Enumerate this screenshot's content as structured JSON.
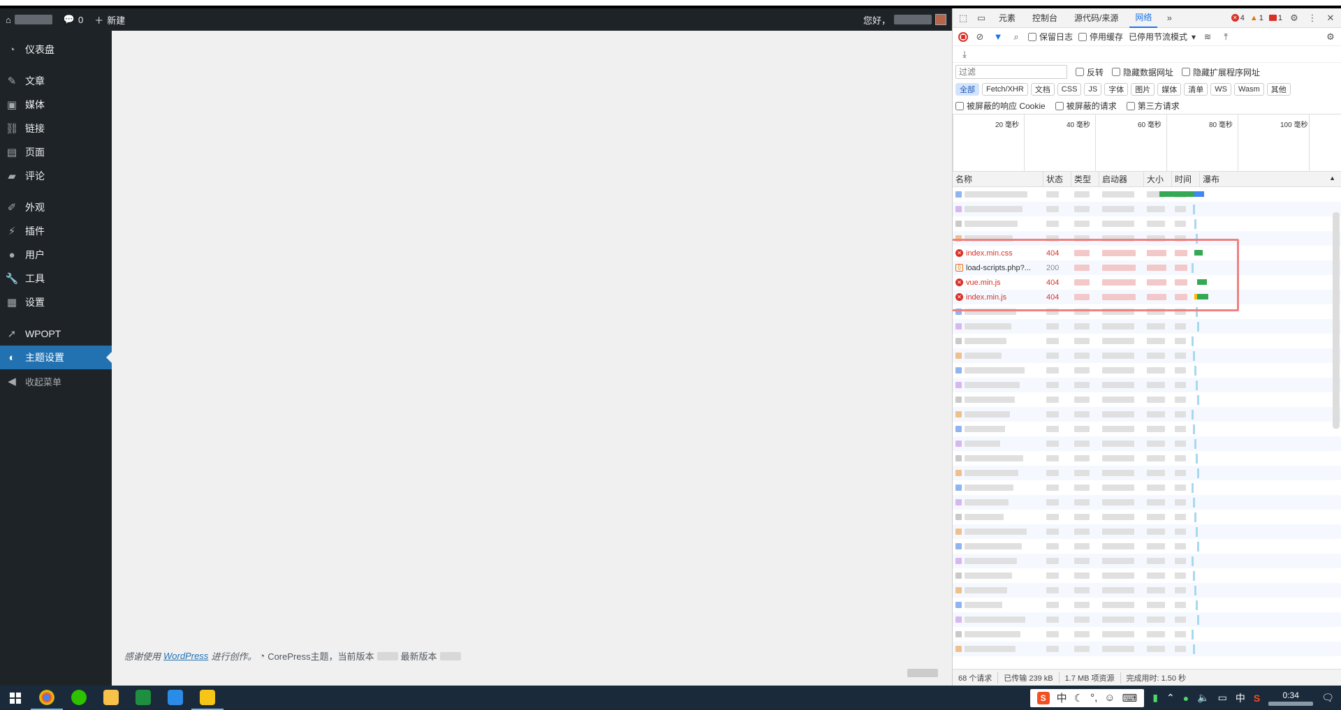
{
  "adminbar": {
    "comments_count": "0",
    "new_label": "新建",
    "greeting": "您好，"
  },
  "sidebar": {
    "items": [
      {
        "label": "仪表盘",
        "icon": "dashboard-icon"
      },
      {
        "label": "文章",
        "icon": "pin-icon"
      },
      {
        "label": "媒体",
        "icon": "media-icon"
      },
      {
        "label": "链接",
        "icon": "link-icon"
      },
      {
        "label": "页面",
        "icon": "page-icon"
      },
      {
        "label": "评论",
        "icon": "comment-icon"
      },
      {
        "label": "外观",
        "icon": "brush-icon"
      },
      {
        "label": "插件",
        "icon": "plugin-icon"
      },
      {
        "label": "用户",
        "icon": "user-icon"
      },
      {
        "label": "工具",
        "icon": "wrench-icon"
      },
      {
        "label": "设置",
        "icon": "settings-icon"
      },
      {
        "label": "WPOPT",
        "icon": "rocket-icon"
      },
      {
        "label": "主题设置",
        "icon": "theme-icon"
      },
      {
        "label": "收起菜单",
        "icon": "collapse-icon"
      }
    ]
  },
  "footer": {
    "thanks_prefix": "感谢使用",
    "wordpress_link": "WordPress",
    "thanks_suffix": "进行创作。",
    "theme_text": "CorePress主题，当前版本",
    "latest_text": "最新版本"
  },
  "devtools": {
    "tabs": [
      "元素",
      "控制台",
      "源代码/来源",
      "网络"
    ],
    "active_tab": "网络",
    "more": "»",
    "errors": "4",
    "warnings": "1",
    "messages": "1",
    "toolbar": {
      "preserve_log": "保留日志",
      "disable_cache": "停用缓存",
      "throttling": "已停用节流模式"
    },
    "filter": {
      "placeholder": "过滤",
      "invert": "反转",
      "hide_data_urls": "隐藏数据网址",
      "hide_ext_urls": "隐藏扩展程序网址"
    },
    "types": [
      "全部",
      "Fetch/XHR",
      "文档",
      "CSS",
      "JS",
      "字体",
      "图片",
      "媒体",
      "清单",
      "WS",
      "Wasm",
      "其他"
    ],
    "blocked": {
      "cookies": "被屏蔽的响应 Cookie",
      "requests": "被屏蔽的请求",
      "third_party": "第三方请求"
    },
    "timeline_ticks": [
      "20 毫秒",
      "40 毫秒",
      "60 毫秒",
      "80 毫秒",
      "100 毫秒"
    ],
    "columns": [
      "名称",
      "状态",
      "类型",
      "启动器",
      "大小",
      "时间",
      "瀑布"
    ],
    "visible_requests": [
      {
        "name": "index.min.css",
        "status": "404",
        "error": true
      },
      {
        "name": "load-scripts.php?...",
        "status": "200",
        "error": false
      },
      {
        "name": "vue.min.js",
        "status": "404",
        "error": true
      },
      {
        "name": "index.min.js",
        "status": "404",
        "error": true
      }
    ],
    "status_bar": {
      "requests": "68 个请求",
      "transferred": "已传输 239 kB",
      "resources": "1.7 MB 项资源",
      "finish": "完成用时: 1.50 秒"
    }
  },
  "taskbar": {
    "ime_lang": "中",
    "tray_lang": "中",
    "time": "0:34"
  }
}
